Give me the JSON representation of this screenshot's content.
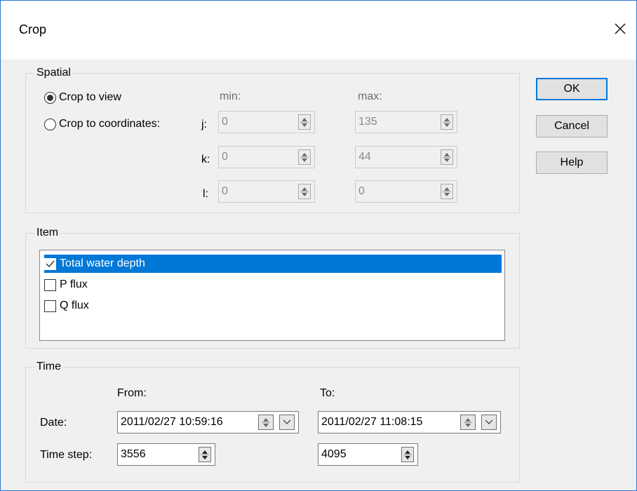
{
  "window": {
    "title": "Crop",
    "close_icon": "close-x-icon"
  },
  "buttons": {
    "ok": "OK",
    "cancel": "Cancel",
    "help": "Help"
  },
  "spatial": {
    "group_label": "Spatial",
    "crop_to_view": "Crop to view",
    "crop_to_coordinates": "Crop to coordinates:",
    "min_header": "min:",
    "max_header": "max:",
    "j": {
      "label": "j:",
      "min": "0",
      "max": "135"
    },
    "k": {
      "label": "k:",
      "min": "0",
      "max": "44"
    },
    "l": {
      "label": "l:",
      "min": "0",
      "max": "0"
    }
  },
  "item": {
    "group_label": "Item",
    "items": [
      {
        "label": "Total water depth",
        "checked": true,
        "selected": true
      },
      {
        "label": "P flux",
        "checked": false,
        "selected": false
      },
      {
        "label": "Q flux",
        "checked": false,
        "selected": false
      }
    ]
  },
  "time": {
    "group_label": "Time",
    "from_label": "From:",
    "to_label": "To:",
    "date_label": "Date:",
    "from_date": "2011/02/27 10:59:16",
    "to_date": "2011/02/27 11:08:15",
    "timestep_label": "Time step:",
    "from_step": "3556",
    "to_step": "4095"
  },
  "colors": {
    "selection": "#0078d7",
    "default_button_border": "#0078d7",
    "window_border": "#2b79d6"
  }
}
